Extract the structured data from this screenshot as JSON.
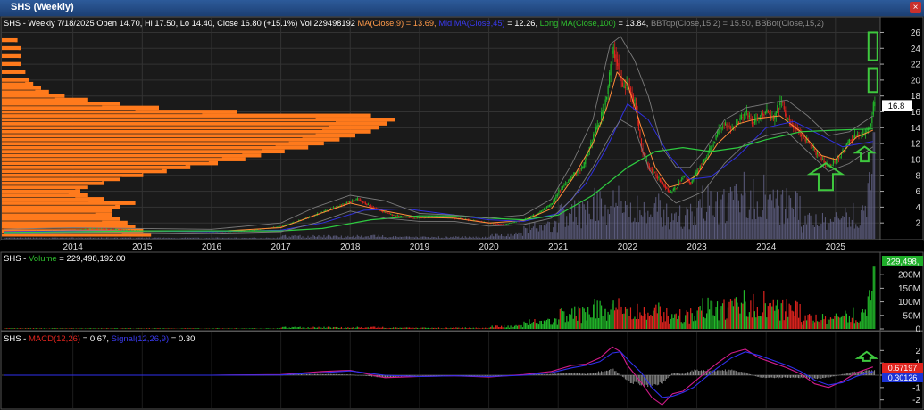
{
  "window": {
    "title": "SHS (Weekly)",
    "close_symbol": "×"
  },
  "main_panel": {
    "ticker": "SHS",
    "legend": [
      {
        "text": "SHS - Weekly 7/18/2025 Open 14.70, Hi 17.50, Lo 14.40, Close 16.80 (+15.1%) Vol 229498192 ",
        "color": "#ffffff"
      },
      {
        "text": "MA(Close,9) = 13.69, ",
        "color": "#ff9a4a"
      },
      {
        "text": "Mid MA(Close,45)",
        "color": "#3a3af0"
      },
      {
        "text": " = 12.26, ",
        "color": "#ffffff"
      },
      {
        "text": "Long MA(Close,100)",
        "color": "#2fbf2f"
      },
      {
        "text": " = 13.84, ",
        "color": "#ffffff"
      },
      {
        "text": "BBTop(Close,15,2) = 15.50, BBBot(Close,15,2)",
        "color": "#8a8a8a"
      }
    ],
    "last_price_label": "16.8"
  },
  "volume_panel": {
    "legend_prefix": "SHS - ",
    "legend_name": "Volume",
    "legend_value": " = 229,498,192.00",
    "last_label": "229,498,"
  },
  "macd_panel": {
    "legend_prefix": "SHS - ",
    "macd_name": "MACD(12,26)",
    "macd_value": " = 0.67, ",
    "signal_name": "Signal(12,26,9)",
    "signal_value": " = 0.30",
    "macd_label": "0.67197",
    "signal_label": "0.30126"
  },
  "colors": {
    "up": "#22b82a",
    "down": "#e0241e",
    "ma9": "#ff8c3a",
    "ma45": "#3030e0",
    "ma100": "#2ecc40",
    "bb": "#7a7a7a",
    "volume_profile": "#ff7a1c",
    "macd_line": "#d21b8a",
    "signal_line": "#3030ee",
    "annotation": "#3ec83e"
  },
  "chart_data": [
    {
      "type": "line",
      "name": "price",
      "x_ticks": [
        "2014",
        "2015",
        "2016",
        "2017",
        "2018",
        "2019",
        "2020",
        "2021",
        "2022",
        "2023",
        "2024",
        "2025"
      ],
      "x_range": [
        2013.0,
        2025.62
      ],
      "y_ticks": [
        2,
        4,
        6,
        8,
        10,
        12,
        14,
        16,
        18,
        20,
        22,
        24,
        26
      ],
      "ylim": [
        0,
        26.5
      ],
      "series": [
        {
          "role": "close",
          "x": [
            2013.0,
            2013.5,
            2014.0,
            2014.3,
            2014.6,
            2015.0,
            2015.5,
            2016.0,
            2016.5,
            2017.0,
            2017.3,
            2017.6,
            2017.9,
            2018.1,
            2018.3,
            2018.6,
            2018.9,
            2019.2,
            2019.5,
            2019.8,
            2020.0,
            2020.2,
            2020.5,
            2020.7,
            2020.9,
            2021.0,
            2021.2,
            2021.35,
            2021.5,
            2021.6,
            2021.7,
            2021.78,
            2021.85,
            2021.92,
            2022.0,
            2022.1,
            2022.2,
            2022.3,
            2022.4,
            2022.5,
            2022.6,
            2022.7,
            2022.8,
            2022.9,
            2023.0,
            2023.1,
            2023.2,
            2023.3,
            2023.4,
            2023.5,
            2023.6,
            2023.7,
            2023.8,
            2023.9,
            2024.0,
            2024.1,
            2024.2,
            2024.3,
            2024.4,
            2024.5,
            2024.6,
            2024.7,
            2024.8,
            2024.9,
            2025.0,
            2025.1,
            2025.2,
            2025.3,
            2025.4,
            2025.46,
            2025.5,
            2025.54
          ],
          "y": [
            0.9,
            1.0,
            1.1,
            1.3,
            1.2,
            1.0,
            1.0,
            0.9,
            1.0,
            1.6,
            2.4,
            3.4,
            4.4,
            5.0,
            4.0,
            3.0,
            2.6,
            2.8,
            2.6,
            2.3,
            2.0,
            1.8,
            2.4,
            3.2,
            4.4,
            6.0,
            8.0,
            9.0,
            13.0,
            15.0,
            18.5,
            24.0,
            22.0,
            19.0,
            19.5,
            17.0,
            11.0,
            9.0,
            8.0,
            7.0,
            5.8,
            6.5,
            8.0,
            7.0,
            8.5,
            10.0,
            11.5,
            13.5,
            14.5,
            14.0,
            15.0,
            16.0,
            14.5,
            15.5,
            16.0,
            15.0,
            17.5,
            15.0,
            14.0,
            13.0,
            12.0,
            11.0,
            10.0,
            9.0,
            10.0,
            11.0,
            12.5,
            13.0,
            13.0,
            14.0,
            14.6,
            16.8
          ]
        },
        {
          "role": "ma9",
          "x": [
            2013.0,
            2014.0,
            2015.0,
            2016.0,
            2017.0,
            2017.5,
            2018.0,
            2018.5,
            2019.0,
            2019.5,
            2020.0,
            2020.5,
            2020.9,
            2021.2,
            2021.5,
            2021.7,
            2021.85,
            2022.0,
            2022.2,
            2022.4,
            2022.6,
            2022.8,
            2023.0,
            2023.3,
            2023.6,
            2023.9,
            2024.2,
            2024.5,
            2024.8,
            2025.0,
            2025.3,
            2025.54
          ],
          "y": [
            0.9,
            1.1,
            1.0,
            0.9,
            1.4,
            3.0,
            4.5,
            3.5,
            2.7,
            2.6,
            2.0,
            2.3,
            3.8,
            7.5,
            12.0,
            16.5,
            21.0,
            19.5,
            14.0,
            9.0,
            6.5,
            7.0,
            8.0,
            12.0,
            14.5,
            15.2,
            15.5,
            13.5,
            10.5,
            10.0,
            12.8,
            13.69
          ]
        },
        {
          "role": "ma45",
          "x": [
            2013.0,
            2014.0,
            2015.0,
            2016.0,
            2017.0,
            2017.6,
            2018.2,
            2018.8,
            2019.5,
            2020.0,
            2020.5,
            2021.0,
            2021.4,
            2021.7,
            2022.0,
            2022.3,
            2022.6,
            2022.9,
            2023.2,
            2023.6,
            2024.0,
            2024.4,
            2024.8,
            2025.1,
            2025.54
          ],
          "y": [
            0.9,
            1.0,
            1.0,
            0.9,
            1.1,
            2.0,
            3.6,
            3.8,
            3.0,
            2.4,
            2.2,
            3.2,
            7.0,
            11.5,
            17.0,
            15.0,
            10.5,
            7.5,
            7.8,
            10.5,
            14.0,
            14.8,
            13.0,
            11.6,
            12.26
          ]
        },
        {
          "role": "ma100",
          "x": [
            2013.0,
            2014.0,
            2015.0,
            2016.0,
            2017.0,
            2017.6,
            2018.3,
            2019.0,
            2019.6,
            2020.0,
            2020.5,
            2021.0,
            2021.5,
            2022.0,
            2022.4,
            2022.8,
            2023.2,
            2023.6,
            2024.0,
            2024.5,
            2025.0,
            2025.54
          ],
          "y": [
            0.8,
            0.9,
            1.0,
            1.0,
            1.0,
            1.3,
            2.4,
            2.9,
            2.9,
            2.6,
            2.4,
            3.0,
            5.5,
            9.0,
            11.0,
            11.5,
            11.0,
            11.5,
            12.5,
            13.5,
            13.7,
            13.84
          ]
        },
        {
          "role": "bbtop",
          "x": [
            2013.0,
            2014.0,
            2015.0,
            2016.0,
            2017.0,
            2017.5,
            2018.0,
            2018.5,
            2019.0,
            2019.5,
            2020.0,
            2020.5,
            2020.9,
            2021.2,
            2021.5,
            2021.75,
            2021.9,
            2022.1,
            2022.3,
            2022.5,
            2022.7,
            2022.9,
            2023.1,
            2023.4,
            2023.7,
            2024.0,
            2024.3,
            2024.6,
            2024.9,
            2025.2,
            2025.54
          ],
          "y": [
            1.2,
            1.4,
            1.3,
            1.2,
            2.0,
            4.0,
            5.5,
            4.8,
            3.2,
            3.0,
            2.6,
            3.0,
            5.0,
            9.5,
            15.0,
            24.5,
            25.5,
            22.5,
            18.0,
            11.5,
            9.0,
            9.0,
            11.0,
            15.0,
            16.5,
            17.0,
            17.5,
            15.5,
            13.0,
            13.5,
            15.5
          ]
        },
        {
          "role": "bbbot",
          "x": [
            2013.0,
            2014.0,
            2015.0,
            2016.0,
            2017.0,
            2017.5,
            2018.0,
            2018.5,
            2019.0,
            2019.5,
            2020.0,
            2020.5,
            2020.9,
            2021.2,
            2021.5,
            2021.75,
            2021.9,
            2022.1,
            2022.3,
            2022.5,
            2022.7,
            2022.9,
            2023.1,
            2023.4,
            2023.7,
            2024.0,
            2024.3,
            2024.6,
            2024.9,
            2025.2,
            2025.54
          ],
          "y": [
            0.7,
            0.8,
            0.8,
            0.7,
            0.9,
            2.0,
            3.5,
            2.6,
            2.2,
            2.2,
            1.6,
            1.8,
            2.6,
            5.0,
            9.0,
            13.0,
            15.0,
            14.0,
            9.0,
            6.0,
            4.5,
            5.2,
            6.0,
            9.5,
            12.0,
            13.0,
            13.5,
            11.0,
            8.5,
            9.5,
            11.6
          ]
        }
      ],
      "volume_profile": {
        "price_levels": [
          0.5,
          1,
          1.5,
          2,
          2.5,
          3,
          3.5,
          4,
          4.5,
          5,
          5.5,
          6,
          6.5,
          7,
          7.5,
          8,
          8.5,
          9,
          9.5,
          10,
          10.5,
          11,
          11.5,
          12,
          12.5,
          13,
          13.5,
          14,
          14.5,
          15,
          15.5,
          16,
          16.5,
          17,
          17.5,
          18,
          18.5,
          19,
          19.5,
          20,
          21,
          22,
          23,
          24,
          25
        ],
        "relative_volume": [
          0.38,
          0.36,
          0.34,
          0.32,
          0.3,
          0.28,
          0.28,
          0.3,
          0.34,
          0.26,
          0.22,
          0.2,
          0.22,
          0.26,
          0.3,
          0.36,
          0.42,
          0.48,
          0.55,
          0.62,
          0.66,
          0.72,
          0.78,
          0.82,
          0.86,
          0.9,
          0.94,
          0.96,
          0.98,
          1.0,
          0.94,
          0.6,
          0.4,
          0.3,
          0.22,
          0.16,
          0.12,
          0.1,
          0.08,
          0.07,
          0.06,
          0.05,
          0.05,
          0.05,
          0.04
        ]
      },
      "annotations": [
        {
          "shape": "up-arrow",
          "x": 2024.86,
          "y": 7.5,
          "size": "large"
        },
        {
          "shape": "up-arrow",
          "x": 2025.42,
          "y": 10.5,
          "size": "small"
        },
        {
          "shape": "rectangle",
          "x": 2025.54,
          "y_from": 18.5,
          "y_to": 21.5
        },
        {
          "shape": "rectangle",
          "x": 2025.54,
          "y_from": 22.5,
          "y_to": 26.0
        }
      ]
    },
    {
      "type": "bar",
      "name": "volume",
      "y_ticks": [
        0,
        50,
        100,
        150,
        200
      ],
      "y_tick_labels": [
        "0",
        "50M",
        "100M",
        "150M",
        "200M"
      ],
      "ylim": [
        0,
        240
      ],
      "segments": [
        {
          "from": 2013.0,
          "to": 2017.0,
          "level": 2
        },
        {
          "from": 2017.0,
          "to": 2018.5,
          "level": 6
        },
        {
          "from": 2018.5,
          "to": 2020.0,
          "level": 4
        },
        {
          "from": 2020.0,
          "to": 2020.5,
          "level": 10
        },
        {
          "from": 2020.5,
          "to": 2021.0,
          "level": 30
        },
        {
          "from": 2021.0,
          "to": 2021.5,
          "level": 60
        },
        {
          "from": 2021.5,
          "to": 2022.0,
          "level": 85
        },
        {
          "from": 2022.0,
          "to": 2022.5,
          "level": 70
        },
        {
          "from": 2022.5,
          "to": 2023.0,
          "level": 55
        },
        {
          "from": 2023.0,
          "to": 2023.5,
          "level": 85
        },
        {
          "from": 2023.5,
          "to": 2024.0,
          "level": 105
        },
        {
          "from": 2024.0,
          "to": 2024.5,
          "level": 80
        },
        {
          "from": 2024.5,
          "to": 2025.0,
          "level": 40
        },
        {
          "from": 2025.0,
          "to": 2025.45,
          "level": 60
        },
        {
          "from": 2025.45,
          "to": 2025.56,
          "level": 120
        }
      ],
      "last_value": 229.5
    },
    {
      "type": "line",
      "name": "macd",
      "y_ticks": [
        -2,
        -1,
        0,
        1,
        2
      ],
      "ylim": [
        -2.6,
        2.6
      ],
      "series": [
        {
          "role": "macd",
          "x": [
            2013.0,
            2016.0,
            2017.0,
            2017.6,
            2018.0,
            2018.5,
            2019.0,
            2019.5,
            2020.0,
            2020.5,
            2020.9,
            2021.2,
            2021.4,
            2021.6,
            2021.78,
            2021.9,
            2022.0,
            2022.2,
            2022.35,
            2022.5,
            2022.65,
            2022.8,
            2022.95,
            2023.1,
            2023.3,
            2023.5,
            2023.7,
            2023.9,
            2024.1,
            2024.3,
            2024.5,
            2024.7,
            2024.9,
            2025.1,
            2025.3,
            2025.54
          ],
          "y": [
            0.0,
            0.0,
            0.05,
            0.3,
            0.4,
            -0.2,
            -0.1,
            -0.05,
            -0.15,
            0.05,
            0.3,
            0.8,
            0.9,
            1.4,
            2.3,
            1.9,
            0.8,
            -0.6,
            -1.8,
            -2.4,
            -1.5,
            -1.3,
            -0.6,
            0.1,
            1.0,
            1.8,
            2.1,
            1.4,
            1.0,
            0.6,
            0.1,
            -0.7,
            -1.0,
            -0.5,
            0.2,
            0.67
          ]
        },
        {
          "role": "signal",
          "x": [
            2013.0,
            2016.0,
            2017.0,
            2017.6,
            2018.0,
            2018.5,
            2019.0,
            2019.5,
            2020.0,
            2020.5,
            2020.9,
            2021.2,
            2021.4,
            2021.6,
            2021.78,
            2021.9,
            2022.0,
            2022.2,
            2022.35,
            2022.5,
            2022.65,
            2022.8,
            2022.95,
            2023.1,
            2023.3,
            2023.5,
            2023.7,
            2023.9,
            2024.1,
            2024.3,
            2024.5,
            2024.7,
            2024.9,
            2025.1,
            2025.3,
            2025.54
          ],
          "y": [
            0.0,
            0.0,
            0.02,
            0.2,
            0.35,
            0.0,
            -0.1,
            -0.05,
            -0.1,
            0.0,
            0.2,
            0.6,
            0.8,
            1.1,
            1.8,
            1.9,
            1.3,
            0.2,
            -1.0,
            -1.8,
            -1.7,
            -1.4,
            -1.0,
            -0.3,
            0.6,
            1.4,
            1.9,
            1.6,
            1.2,
            0.8,
            0.3,
            -0.4,
            -0.8,
            -0.6,
            -0.1,
            0.3
          ]
        }
      ],
      "annotations": [
        {
          "shape": "up-arrow",
          "x": 2025.45,
          "y": 1.6
        }
      ]
    }
  ]
}
